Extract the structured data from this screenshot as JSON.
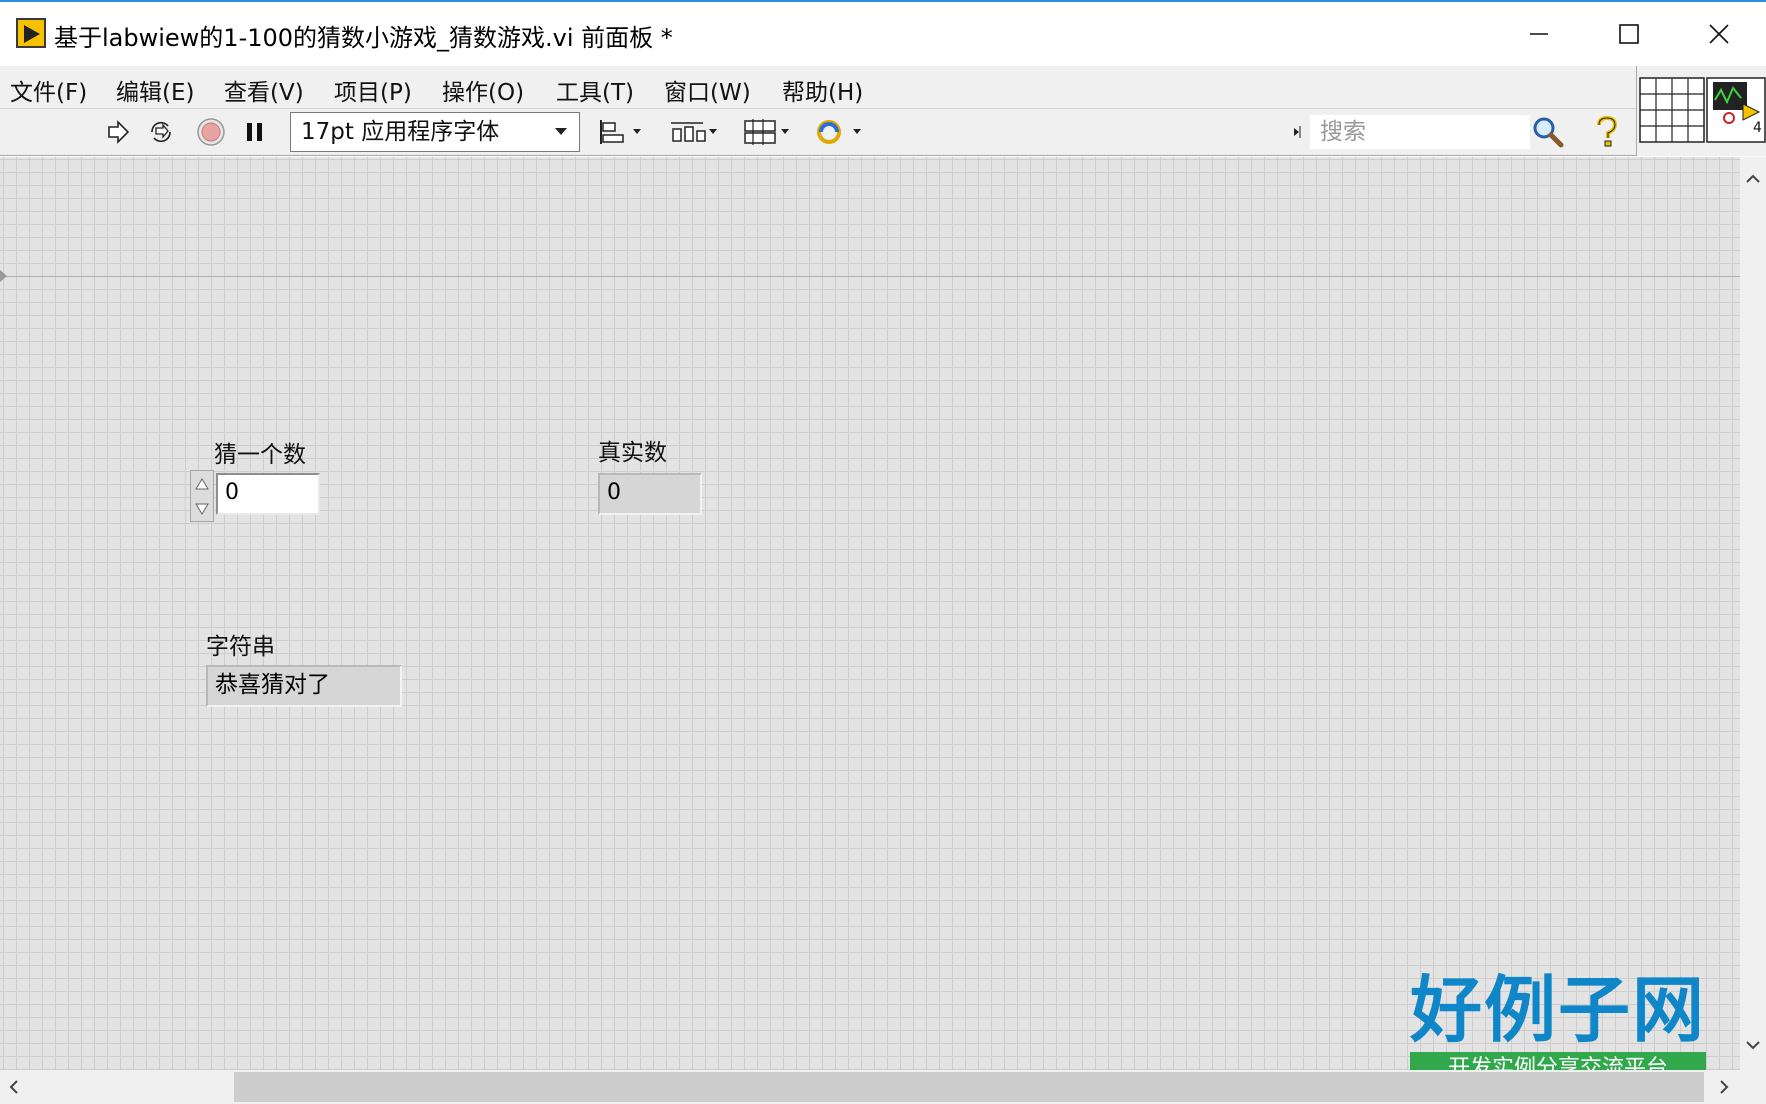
{
  "window": {
    "title": "基于labwiew的1-100的猜数小游戏_猜数游戏.vi 前面板 *",
    "minimize_glyph": "—",
    "maximize_glyph": "☐",
    "close_glyph": "✕"
  },
  "menu": {
    "items": [
      {
        "label": "文件(F)"
      },
      {
        "label": "编辑(E)"
      },
      {
        "label": "查看(V)"
      },
      {
        "label": "项目(P)"
      },
      {
        "label": "操作(O)"
      },
      {
        "label": "工具(T)"
      },
      {
        "label": "窗口(W)"
      },
      {
        "label": "帮助(H)"
      }
    ]
  },
  "toolbar": {
    "font_selector": "17pt 应用程序字体",
    "search_placeholder": "搜索",
    "icons": [
      "run-arrow-icon",
      "run-continuously-icon",
      "abort-icon",
      "pause-icon",
      "align-objects-icon",
      "distribute-objects-icon",
      "resize-objects-icon",
      "reorder-icon",
      "search-icon",
      "context-help-icon"
    ]
  },
  "connector_pane": {
    "terminal_count_label": "4"
  },
  "front_panel": {
    "guess_control": {
      "label": "猜一个数",
      "value": "0"
    },
    "real_number_indicator": {
      "label": "真实数",
      "value": "0"
    },
    "string_indicator": {
      "label": "字符串",
      "value": "恭喜猜对了"
    }
  },
  "watermark": {
    "logo_title": "好例子网",
    "logo_subtitle": "开发实例分享交流平台",
    "colors": {
      "title": "#0e86c8",
      "subtitle_bg": "#32a84c"
    }
  }
}
